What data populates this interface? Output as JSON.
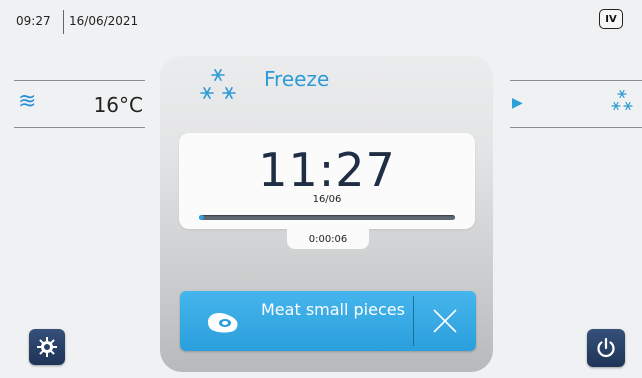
{
  "status_bar": {
    "time": "09:27",
    "date": "16/06/2021",
    "level_badge": "IV"
  },
  "left_panel": {
    "icon": "heat-waves-icon",
    "temperature": "16°C"
  },
  "right_panel": {
    "arrow_icon": "play-arrow-icon",
    "icon": "snowflakes-icon"
  },
  "program": {
    "name": "Freeze",
    "icon": "snowflakes-icon"
  },
  "clock": {
    "time": "11:27",
    "date": "16/06",
    "progress_fraction": 0.01,
    "elapsed": "0:00:06"
  },
  "program_button": {
    "label": "Meat small pieces",
    "icon": "meat-icon",
    "cancel_icon": "close-icon"
  },
  "buttons": {
    "settings_icon": "gear-icon",
    "power_icon": "power-icon"
  },
  "colors": {
    "accent": "#2e9bd6",
    "button_blue": "#3aaee6",
    "dark_button": "#2a4066",
    "progress_track": "#5f6872"
  }
}
